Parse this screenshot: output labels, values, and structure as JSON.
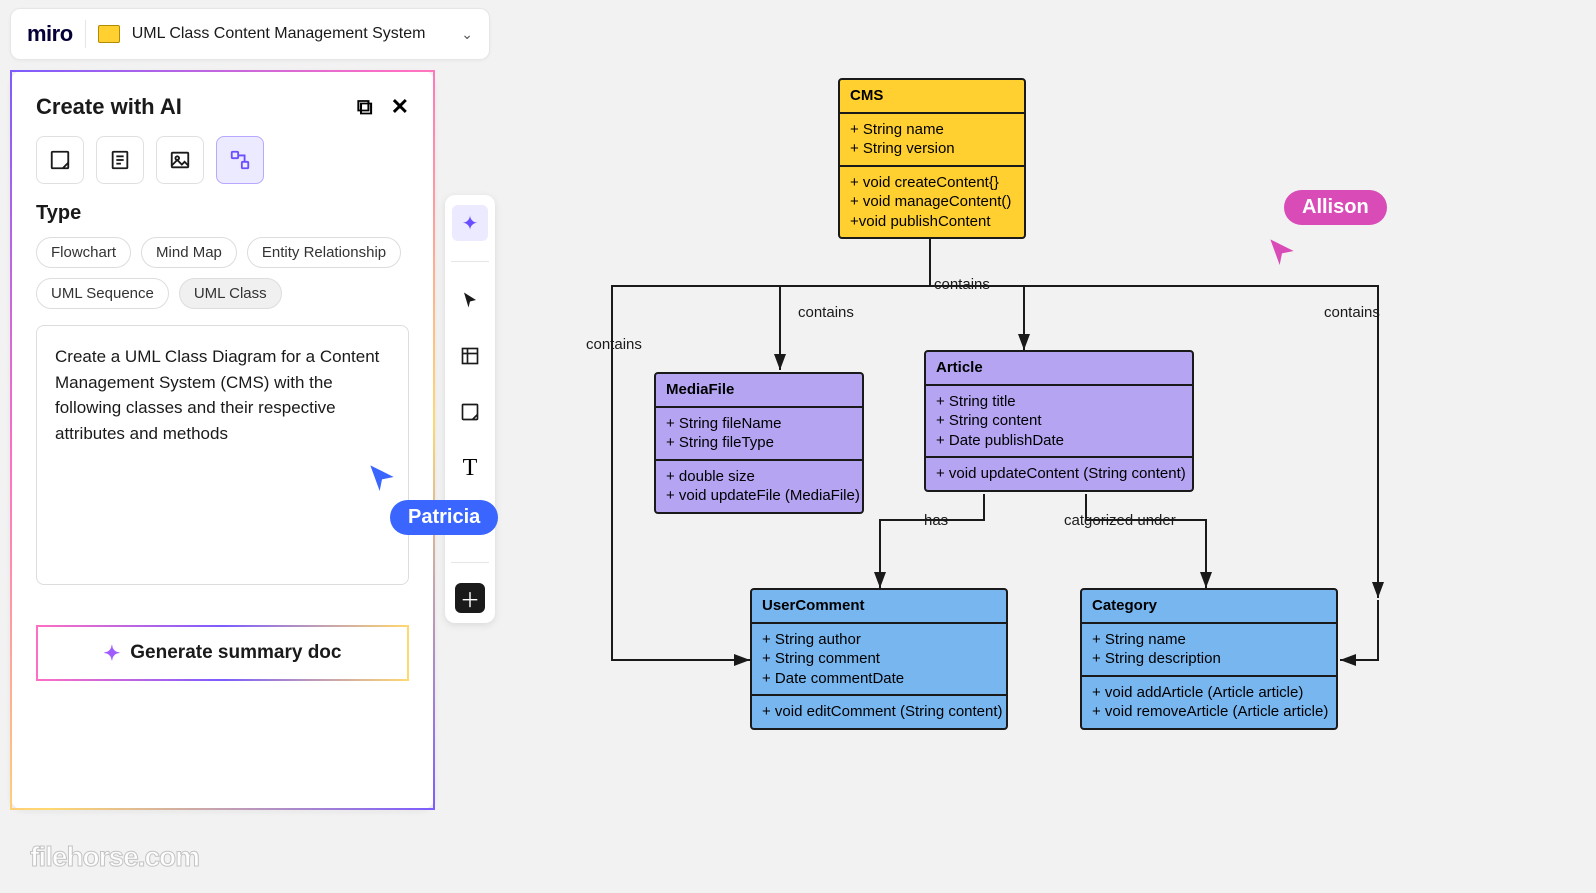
{
  "header": {
    "logo_text": "miro",
    "board_name": "UML Class Content Management System"
  },
  "ai_panel": {
    "title": "Create with AI",
    "modes": [
      "sticky-note",
      "document",
      "image",
      "diagram"
    ],
    "type_label": "Type",
    "chips": [
      "Flowchart",
      "Mind Map",
      "Entity Relationship",
      "UML Sequence",
      "UML Class"
    ],
    "selected_chip_index": 4,
    "prompt_text": "Create a UML Class Diagram for a Content Management System (CMS) with the following classes and their respective attributes and methods",
    "generate_button": "Generate summary doc"
  },
  "toolbar": {
    "tools": [
      "ai",
      "cursor",
      "frame",
      "sticky",
      "text",
      "shapes",
      "add"
    ]
  },
  "presence": {
    "patricia": "Patricia",
    "allison": "Allison"
  },
  "uml": {
    "cms": {
      "name": "CMS",
      "attrs": [
        "+ String name",
        "+ String version"
      ],
      "methods": [
        "+ void createContent{}",
        "+ void manageContent()",
        "+void publishContent"
      ]
    },
    "mediafile": {
      "name": "MediaFile",
      "attrs": [
        "+ String fileName",
        "+ String fileType"
      ],
      "methods": [
        "+ double size",
        "+ void updateFile (MediaFile)"
      ]
    },
    "article": {
      "name": "Article",
      "attrs": [
        "+ String title",
        "+ String content",
        "+ Date publishDate"
      ],
      "methods": [
        "+ void updateContent (String content)"
      ]
    },
    "usercomment": {
      "name": "UserComment",
      "attrs": [
        "+ String author",
        "+ String comment",
        "+ Date commentDate"
      ],
      "methods": [
        "+ void editComment (String content)"
      ]
    },
    "category": {
      "name": "Category",
      "attrs": [
        "+ String name",
        "+ String description"
      ],
      "methods": [
        "+ void addArticle (Article article)",
        "+ void removeArticle (Article article)"
      ]
    }
  },
  "edges": {
    "contains1": "contains",
    "contains2": "contains",
    "contains3": "contains",
    "contains4": "contains",
    "has": "has",
    "catunder": "catgorized under"
  },
  "watermark": {
    "text": "filehorse",
    "tld": ".com"
  }
}
